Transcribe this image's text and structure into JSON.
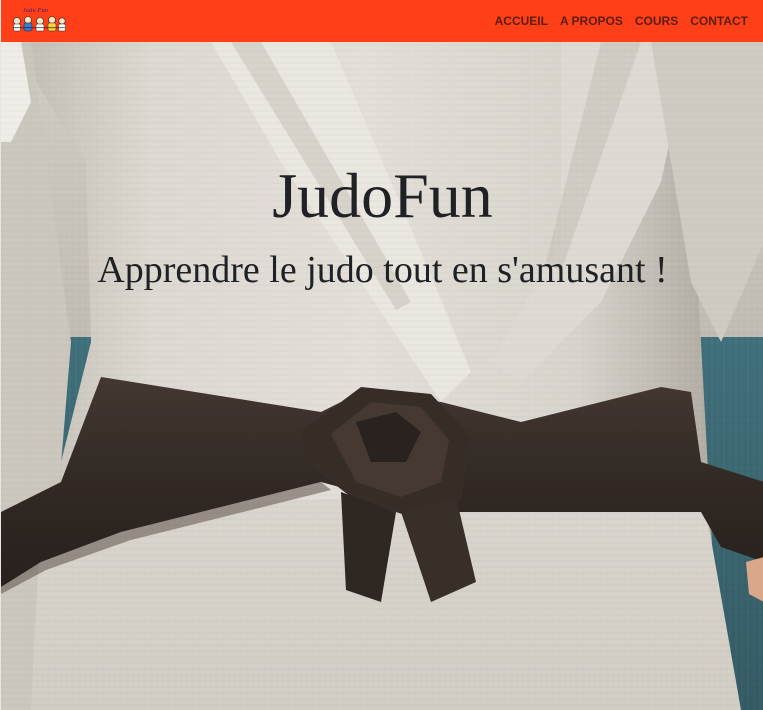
{
  "navbar": {
    "logo_text": "Judo Fun",
    "links": [
      {
        "label": "ACCUEIL"
      },
      {
        "label": "A PROPOS"
      },
      {
        "label": "COURS"
      },
      {
        "label": "CONTACT"
      }
    ]
  },
  "hero": {
    "title": "JudoFun",
    "subtitle": "Apprendre le judo tout en s'amusant !"
  },
  "colors": {
    "navbar_bg": "#ff3f17",
    "nav_link": "#5a1e12",
    "hero_text": "#1f2124",
    "gi_white": "#d9d6cf",
    "belt_black": "#2a211c",
    "wall_teal": "#2f5e6a"
  }
}
